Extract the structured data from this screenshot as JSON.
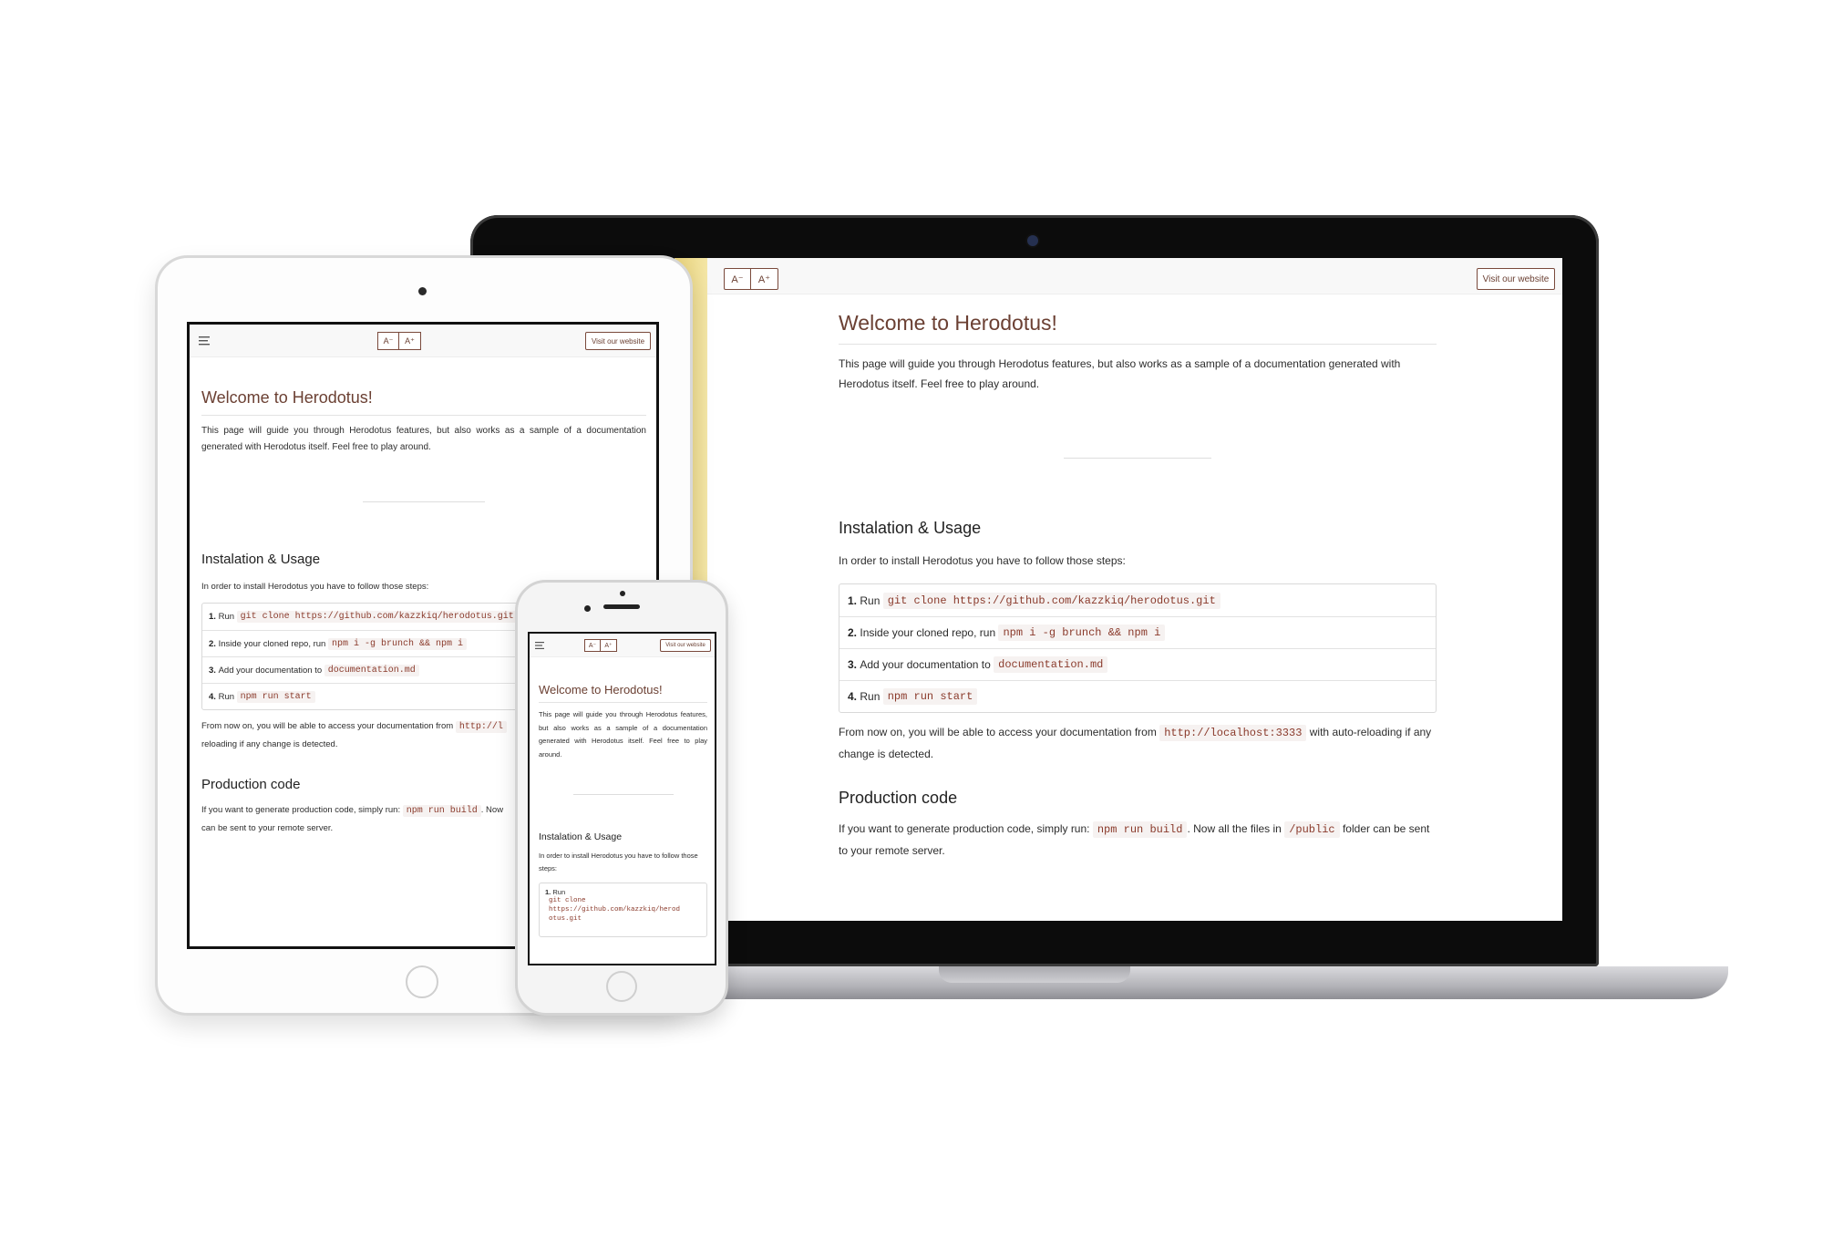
{
  "toolbar": {
    "font_decrease": "A⁻",
    "font_increase": "A⁺",
    "visit_website": "Visit our website",
    "menu_icon": "hamburger-menu-icon"
  },
  "content": {
    "title": "Welcome to Herodotus!",
    "intro": "This page will guide you through Herodotus features, but also works as a sample of a documentation generated with Herodotus itself. Feel free to play around.",
    "install_heading": "Instalation & Usage",
    "install_intro": "In order to install Herodotus you have to follow those steps:",
    "steps": [
      {
        "num": "1.",
        "text": "Run",
        "code": "git clone https://github.com/kazzkiq/herodotus.git"
      },
      {
        "num": "2.",
        "text": "Inside your cloned repo, run",
        "code": "npm i -g brunch && npm i"
      },
      {
        "num": "3.",
        "text": "Add your documentation to",
        "code": "documentation.md"
      },
      {
        "num": "4.",
        "text": "Run",
        "code": "npm run start"
      }
    ],
    "access_text_1": "From now on, you will be able to access your documentation from",
    "access_code": "http://localhost:3333",
    "access_text_2": "with auto-reloading if any change is detected.",
    "prod_heading": "Production code",
    "prod_text_1": "If you want to generate production code, simply run:",
    "prod_code": "npm run build",
    "prod_text_2": ". Now all the files in",
    "prod_code_2": "/public",
    "prod_text_3": "folder can be sent to your remote server.",
    "tablet": {
      "step1_code": "git clone https://github.com/kazzkiq/herodotus.git",
      "access_code_trunc": "http://l",
      "access_text_2": "reloading if any change is detected.",
      "prod_text_2": ". Now",
      "prod_text_3": "can be sent to your remote server."
    },
    "phone": {
      "step1_code_a": "git clone",
      "step1_code_b": "https://github.com/kazzkiq/herod",
      "step1_code_c": "otus.git"
    }
  },
  "colors": {
    "accent": "#6b4033",
    "code_text": "#8a3a2b",
    "code_bg": "#f6f2f1",
    "laptop_sidebar": "#f0df90"
  }
}
